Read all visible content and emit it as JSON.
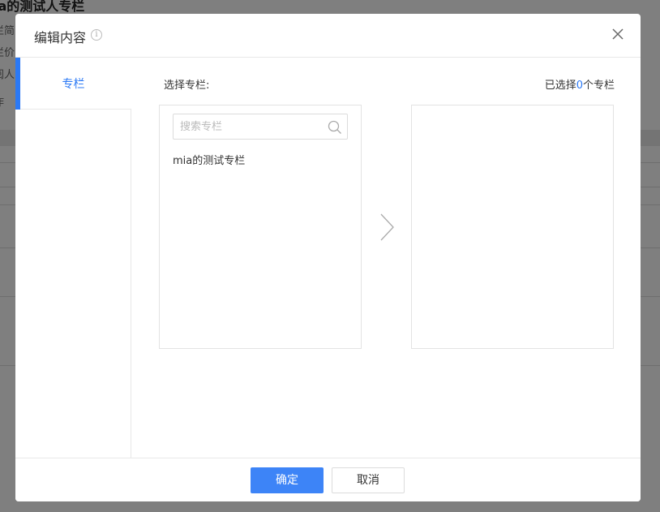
{
  "background": {
    "title": "ia的测试人专栏",
    "lines": [
      "栏简",
      "栏价",
      "阅人",
      "作"
    ]
  },
  "modal": {
    "title": "编辑内容",
    "info_symbol": "i",
    "side_nav": {
      "active_tab": "专栏"
    },
    "select_label": "选择专栏:",
    "selected": {
      "prefix": "已选择",
      "count": "0",
      "suffix": "个专栏"
    },
    "search": {
      "placeholder": "搜索专栏",
      "value": ""
    },
    "list_items": [
      "mia的测试专栏"
    ],
    "footer": {
      "ok_label": "确定",
      "cancel_label": "取消"
    }
  },
  "colors": {
    "accent": "#2b79f5",
    "primary_button": "#3d84f7",
    "overlay": "rgba(0,0,0,0.5)"
  },
  "icons": {
    "info": "info-circle-icon",
    "close": "close-icon",
    "search": "search-icon",
    "transfer": "chevron-right-icon"
  }
}
